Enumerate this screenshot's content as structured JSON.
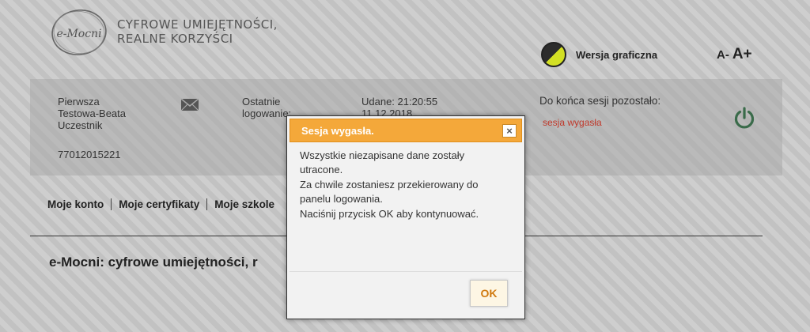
{
  "header": {
    "logo_text": "e-Mocni",
    "tagline": [
      "CYFROWE UMIEJĘTNOŚCI,",
      "REALNE KORZYŚCI"
    ],
    "contrast_label": "Wersja graficzna",
    "font_decrease": "A-",
    "font_increase": "A+"
  },
  "user": {
    "name_lines": [
      "Pierwsza",
      "Testowa-Beata",
      "Uczestnik"
    ],
    "id": "77012015221",
    "last_login_label": [
      "Ostatnie",
      "logowanie:"
    ],
    "last_login_value": [
      "Udane: 21:20:55",
      "11.12.2018"
    ],
    "session_label": "Do końca sesji pozostało:",
    "session_status": "sesja wygasła"
  },
  "nav": {
    "items": [
      {
        "label": "Moje konto"
      },
      {
        "label": "Moje certyfikaty"
      },
      {
        "label": "Moje szkole"
      }
    ]
  },
  "main": {
    "title": "e-Mocni: cyfrowe umiejętności, r"
  },
  "dialog": {
    "title": "Sesja wygasła.",
    "close_symbol": "×",
    "message_lines": [
      "Wszystkie niezapisane dane zostały utracone.",
      "Za chwile zostaniesz przekierowany do panelu logowania.",
      "Naciśnij przycisk OK aby kontynuować."
    ],
    "ok_label": "OK"
  },
  "colors": {
    "dialog_header": "#f4a83a",
    "session_status": "#c0392b",
    "ok_text": "#d07a10",
    "power_icon": "#3a6b4a"
  },
  "icons": [
    "mail-icon",
    "power-icon",
    "close-icon",
    "contrast-icon"
  ]
}
